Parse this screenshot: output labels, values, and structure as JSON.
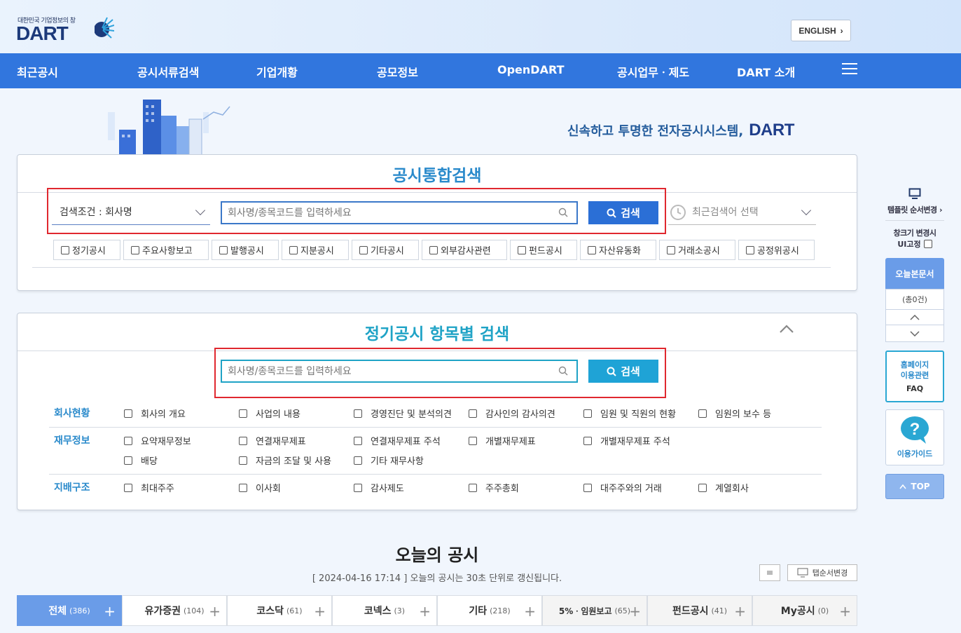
{
  "header": {
    "logo_subtitle": "대한민국 기업정보의 창",
    "logo_text": "DART",
    "english_label": "ENGLISH"
  },
  "nav": [
    "최근공시",
    "공시서류검색",
    "기업개황",
    "공모정보",
    "OpenDART",
    "공시업무ㆍ제도",
    "DART 소개"
  ],
  "slogan": {
    "text": "신속하고 투명한 전자공시시스템,",
    "brand": "DART"
  },
  "integrated_search": {
    "title": "공시통합검색",
    "condition_label": "검색조건 : 회사명",
    "placeholder": "회사명/종목코드를 입력하세요",
    "search_button": "검색",
    "recent_label": "최근검색어 선택",
    "filters": [
      "정기공시",
      "주요사항보고",
      "발행공시",
      "지분공시",
      "기타공시",
      "외부감사관련",
      "펀드공시",
      "자산유동화",
      "거래소공시",
      "공정위공시"
    ]
  },
  "periodic_search": {
    "title": "정기공시 항목별 검색",
    "placeholder": "회사명/종목코드를 입력하세요",
    "search_button": "검색",
    "groups": [
      {
        "label": "회사현황",
        "items": [
          "회사의 개요",
          "사업의 내용",
          "경영진단 및 분석의견",
          "감사인의 감사의견",
          "임원 및 직원의 현황",
          "임원의 보수 등"
        ]
      },
      {
        "label": "재무정보",
        "items": [
          "요약재무정보",
          "연결재무제표",
          "연결재무제표 주석",
          "개별재무제표",
          "개별재무제표 주석",
          "배당",
          "자금의 조달 및 사용",
          "기타 재무사항"
        ]
      },
      {
        "label": "지배구조",
        "items": [
          "최대주주",
          "이사회",
          "감사제도",
          "주주총회",
          "대주주와의 거래",
          "계열회사"
        ]
      }
    ]
  },
  "today": {
    "title": "오늘의 공시",
    "notice": "[ 2024-04-16 17:14 ] 오늘의 공시는 30초 단위로 갱신됩니다.",
    "tab_order_label": "탭순서변경",
    "tabs": [
      {
        "label": "전체",
        "count": "(386)"
      },
      {
        "label": "유가증권",
        "count": "(104)"
      },
      {
        "label": "코스닥",
        "count": "(61)"
      },
      {
        "label": "코넥스",
        "count": "(3)"
      },
      {
        "label": "기타",
        "count": "(218)"
      },
      {
        "label": "5%ㆍ임원보고",
        "count": "(65)"
      },
      {
        "label": "펀드공시",
        "count": "(41)"
      },
      {
        "label": "My공시",
        "count": "(0)"
      }
    ]
  },
  "sidebar": {
    "template_label": "템플릿 순서변경",
    "window_label_1": "창크기 변경시",
    "window_label_2": "UI고정",
    "today_docs_label": "오늘본문서",
    "today_docs_count": "(총0건)",
    "homepage_1": "홈페이지",
    "homepage_2": "이용관련",
    "faq": "FAQ",
    "guide": "이용가이드",
    "top": "TOP"
  },
  "colors": {
    "nav": "#3176de",
    "accent": "#1fa3d6",
    "highlight": "#e0282f"
  }
}
